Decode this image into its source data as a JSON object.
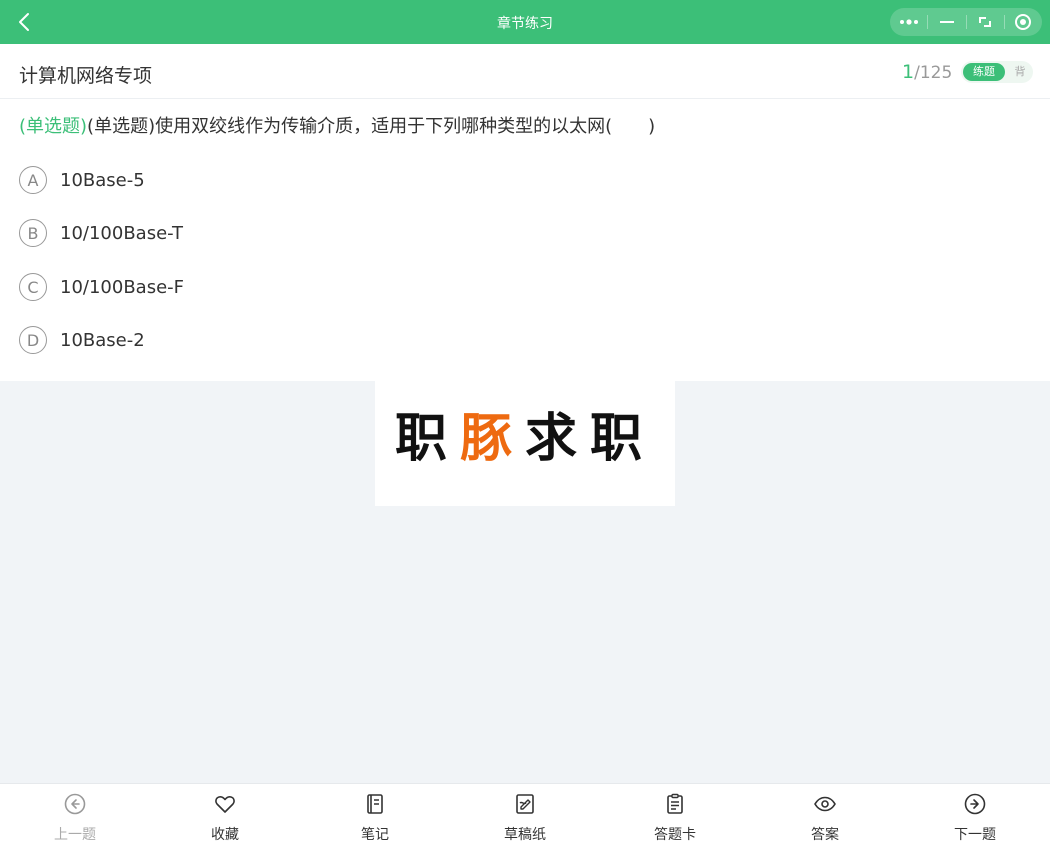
{
  "header": {
    "title": "章节练习"
  },
  "subheader": {
    "section": "计算机网络专项",
    "current": "1",
    "total": "/125",
    "mode_active": "练题",
    "mode_inactive": "背"
  },
  "question": {
    "type_tag": "(单选题)",
    "text": "(单选题)使用双绞线作为传输介质，适用于下列哪种类型的以太网(　　)",
    "options": [
      {
        "letter": "A",
        "text": "10Base-5"
      },
      {
        "letter": "B",
        "text": "10/100Base-T"
      },
      {
        "letter": "C",
        "text": "10/100Base-F"
      },
      {
        "letter": "D",
        "text": "10Base-2"
      }
    ]
  },
  "watermark": {
    "part1": "职",
    "part2": "豚",
    "part3": "求职"
  },
  "bottom_nav": [
    {
      "label": "上一题",
      "icon": "arrow-left-circle-icon"
    },
    {
      "label": "收藏",
      "icon": "heart-icon"
    },
    {
      "label": "笔记",
      "icon": "notebook-icon"
    },
    {
      "label": "草稿纸",
      "icon": "draft-paper-icon"
    },
    {
      "label": "答题卡",
      "icon": "answer-card-icon"
    },
    {
      "label": "答案",
      "icon": "eye-icon"
    },
    {
      "label": "下一题",
      "icon": "arrow-right-circle-icon"
    }
  ],
  "colors": {
    "primary": "#3cbf78",
    "accent": "#ee6a10",
    "page_bg": "#f1f4f7"
  }
}
